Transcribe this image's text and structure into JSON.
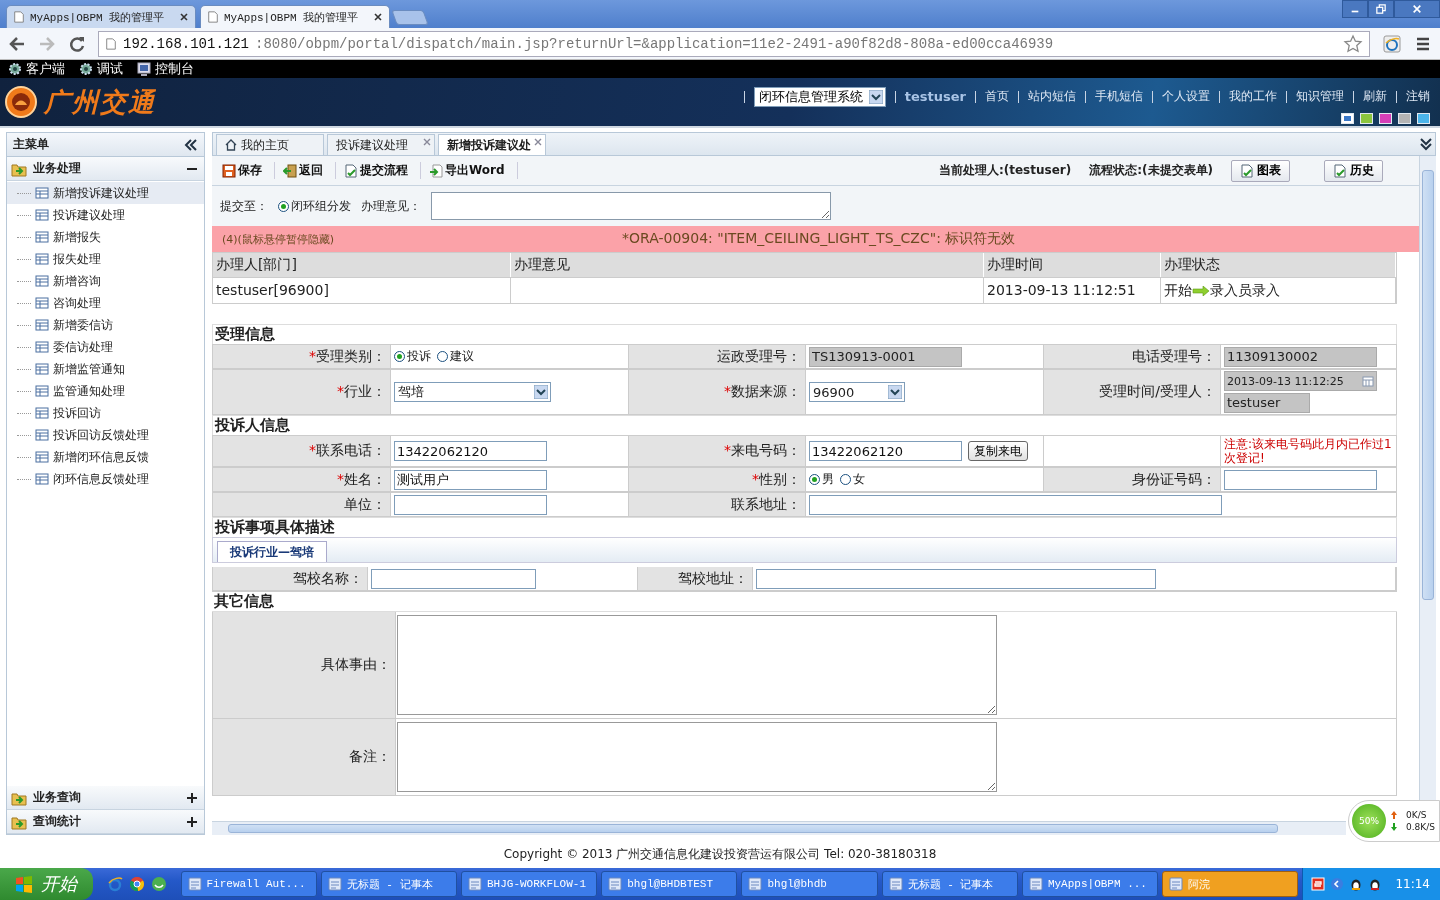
{
  "browser": {
    "tabs": [
      {
        "title": "MyApps|OBPM 我的管理平",
        "selected": false
      },
      {
        "title": "MyApps|OBPM 我的管理平",
        "selected": true
      }
    ],
    "url_host": "192.168.101.121",
    "url_rest": ":8080/obpm/portal/dispatch/main.jsp?returnUrl=&application=11e2-2491-a90f82d8-808a-ed00cca46939"
  },
  "top_toolbar": [
    {
      "label": "客户端",
      "kind": "gear"
    },
    {
      "label": "调试",
      "kind": "gear"
    },
    {
      "label": "控制台",
      "kind": "monitor"
    }
  ],
  "header": {
    "logo_text": "广州交通",
    "system_select": "闭环信息管理系统",
    "user": "testuser",
    "nav": [
      "首页",
      "站内短信",
      "手机短信",
      "个人设置",
      "我的工作",
      "知识管理",
      "刷新",
      "注销"
    ],
    "themes": [
      {
        "color": "#3a78c8",
        "selected": true
      },
      {
        "color": "#8cc63f",
        "selected": false
      },
      {
        "color": "#d63fb8",
        "selected": false
      },
      {
        "color": "#b4b4b4",
        "selected": false
      },
      {
        "color": "#4ab4ea",
        "selected": false
      }
    ]
  },
  "sidebar": {
    "title": "主菜单",
    "sections": [
      {
        "label": "业务处理",
        "expanded": true,
        "items": [
          {
            "label": "新增投诉建议处理",
            "selected": true
          },
          {
            "label": "投诉建议处理",
            "selected": false
          },
          {
            "label": "新增报失",
            "selected": false
          },
          {
            "label": "报失处理",
            "selected": false
          },
          {
            "label": "新增咨询",
            "selected": false
          },
          {
            "label": "咨询处理",
            "selected": false
          },
          {
            "label": "新增委信访",
            "selected": false
          },
          {
            "label": "委信访处理",
            "selected": false
          },
          {
            "label": "新增监管通知",
            "selected": false
          },
          {
            "label": "监管通知处理",
            "selected": false
          },
          {
            "label": "投诉回访",
            "selected": false
          },
          {
            "label": "投诉回访反馈处理",
            "selected": false
          },
          {
            "label": "新增闭环信息反馈",
            "selected": false
          },
          {
            "label": "闭环信息反馈处理",
            "selected": false
          }
        ]
      },
      {
        "label": "业务查询",
        "expanded": false
      },
      {
        "label": "查询统计",
        "expanded": false
      }
    ]
  },
  "tabs": [
    {
      "label": "我的主页",
      "selected": false,
      "kind": "home"
    },
    {
      "label": "投诉建议处理",
      "selected": false,
      "kind": "closable"
    },
    {
      "label": "新增投诉建议处",
      "selected": true,
      "kind": "closable"
    }
  ],
  "toolbar": {
    "buttons": [
      {
        "label": "保存",
        "kind": "save"
      },
      {
        "label": "返回",
        "kind": "back"
      },
      {
        "label": "提交流程",
        "kind": "submit"
      },
      {
        "label": "导出Word",
        "kind": "export"
      }
    ],
    "current_handler": "当前处理人:(testuser)",
    "flow_status": "流程状态:(未提交表单)",
    "right_buttons": [
      "图表",
      "历史"
    ]
  },
  "submit": {
    "label": "提交至：",
    "option": {
      "label": "闭环组分发",
      "selected": true
    },
    "opinion_label": "办理意见："
  },
  "error_bar": {
    "hint": "(4)(鼠标悬停暂停隐藏)",
    "message": "*ORA-00904: \"ITEM_CEILING_LIGHT_TS_CZC\": 标识符无效"
  },
  "history": {
    "columns": [
      "办理人[部门]",
      "办理意见",
      "办理时间",
      "办理状态"
    ],
    "rows": [
      {
        "person": "testuser[96900]",
        "time": "2013-09-13 11:12:51",
        "status_from": "开始",
        "status_to": "录入员录入"
      }
    ]
  },
  "form_sections": [
    {
      "title": "受理信息",
      "rows": [
        [
          {
            "kind": "label",
            "mark": "*",
            "text": "受理类别："
          },
          {
            "kind": "radio",
            "options": [
              {
                "label": "投诉",
                "selected": true
              },
              {
                "label": "建议",
                "selected": false
              }
            ]
          },
          {
            "kind": "label",
            "text": "运政受理号："
          },
          {
            "kind": "input",
            "value": "TS130913-0001",
            "disabled": true
          },
          {
            "kind": "label",
            "text": "电话受理号："
          },
          {
            "kind": "input",
            "value": "11309130002",
            "disabled": true
          }
        ],
        [
          {
            "kind": "label",
            "mark": "*",
            "text": "行业："
          },
          {
            "kind": "select",
            "value": "驾培"
          },
          {
            "kind": "label",
            "mark": "*",
            "text": "数据来源："
          },
          {
            "kind": "select",
            "value": "96900",
            "short": true
          },
          {
            "kind": "label",
            "text": "受理时间/受理人："
          },
          {
            "kind": "datetime",
            "value": "2013-09-13 11:12:25",
            "user": "testuser"
          }
        ]
      ]
    },
    {
      "title": "投诉人信息",
      "rows": [
        [
          {
            "kind": "label",
            "mark": "*",
            "text": "联系电话："
          },
          {
            "kind": "input",
            "value": "13422062120",
            "disabled": false
          },
          {
            "kind": "label",
            "mark": "*",
            "text": "来电号码："
          },
          {
            "kind": "input_button",
            "value": "13422062120",
            "button": "复制来电"
          },
          {
            "kind": "empty"
          },
          {
            "kind": "note",
            "text": "注意:该来电号码此月内已作过1次登记!"
          }
        ],
        [
          {
            "kind": "label",
            "mark": "*",
            "text": "姓名："
          },
          {
            "kind": "input",
            "value": "测试用户",
            "disabled": false
          },
          {
            "kind": "label",
            "mark": "*",
            "text": "性别："
          },
          {
            "kind": "radio",
            "options": [
              {
                "label": "男",
                "selected": true
              },
              {
                "label": "女",
                "selected": false
              }
            ]
          },
          {
            "kind": "label",
            "text": "身份证号码："
          },
          {
            "kind": "input",
            "disabled": false
          }
        ],
        [
          {
            "kind": "label",
            "text": "单位："
          },
          {
            "kind": "input",
            "disabled": false
          },
          {
            "kind": "label",
            "text": "联系地址："
          },
          {
            "kind": "wide_input",
            "disabled": false
          }
        ]
      ]
    }
  ],
  "description": {
    "title": "投诉事项具体描述",
    "subtab": "投诉行业—驾培",
    "fields": [
      "驾校名称：",
      "驾校地址："
    ]
  },
  "other": {
    "title": "其它信息",
    "fields": [
      "具体事由：",
      "备注："
    ]
  },
  "footer": "Copyright © 2013 广州交通信息化建设投资营运有限公司 Tel: 020-38180318",
  "net_meter": {
    "percent": "50%",
    "up": "0K/S",
    "down": "0.8K/S"
  },
  "taskbar": {
    "start": "开始",
    "tasks": [
      {
        "label": "Firewall Aut...",
        "selected": false
      },
      {
        "label": "无标题 - 记事本",
        "selected": false
      },
      {
        "label": "BHJG-WORKFLOW-1",
        "selected": false
      },
      {
        "label": "bhgl@BHDBTEST",
        "selected": false
      },
      {
        "label": "bhgl@bhdb",
        "selected": false
      },
      {
        "label": "无标题 - 记事本",
        "selected": false
      },
      {
        "label": "MyApps|OBPM ...",
        "selected": false
      },
      {
        "label": "阿浣",
        "selected": true
      }
    ],
    "time": "11:14"
  }
}
